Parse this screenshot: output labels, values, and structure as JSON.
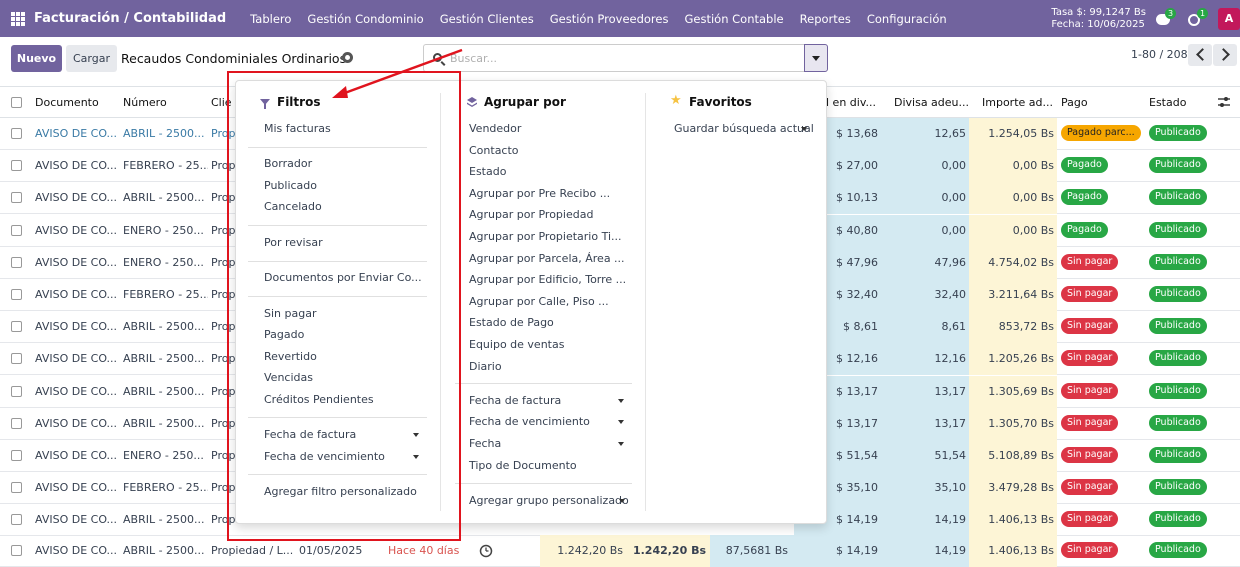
{
  "app": {
    "brand": "Facturación / Contabilidad",
    "menu": [
      "Tablero",
      "Gestión Condominio",
      "Gestión Clientes",
      "Gestión Proveedores",
      "Gestión Contable",
      "Reportes",
      "Configuración"
    ],
    "rate": "Tasa $: 99,1247 Bs",
    "date": "Fecha: 10/06/2025",
    "chat_count": "3",
    "activity_count": "1",
    "avatar": "A"
  },
  "control": {
    "new_label": "Nuevo",
    "upload_label": "Cargar",
    "title": "Recaudos Condominiales Ordinarios",
    "search_placeholder": "Buscar...",
    "pager": "1-80 / 208"
  },
  "table": {
    "headers": [
      "Documento",
      "Número",
      "Clie",
      "l en div...",
      "Divisa adeu...",
      "Importe ad...",
      "Pago",
      "Estado"
    ],
    "rows": [
      {
        "doc": "AVISO DE CO...",
        "num": "ABRIL - 2500...",
        "cli": "Prop",
        "usd": "$ 13,68",
        "div": "12,65",
        "imp": "1.254,05 Bs",
        "pago": "Pagado parc...",
        "pago_type": "orange",
        "estado": "Publicado",
        "link": true
      },
      {
        "doc": "AVISO DE CO...",
        "num": "FEBRERO - 25...",
        "cli": "Prop",
        "usd": "$ 27,00",
        "div": "0,00",
        "imp": "0,00 Bs",
        "pago": "Pagado",
        "pago_type": "green",
        "estado": "Publicado"
      },
      {
        "doc": "AVISO DE CO...",
        "num": "ABRIL - 2500...",
        "cli": "Prop",
        "usd": "$ 10,13",
        "div": "0,00",
        "imp": "0,00 Bs",
        "pago": "Pagado",
        "pago_type": "green",
        "estado": "Publicado"
      },
      {
        "doc": "AVISO DE CO...",
        "num": "ENERO - 250...",
        "cli": "Prop",
        "usd": "$ 40,80",
        "div": "0,00",
        "imp": "0,00 Bs",
        "pago": "Pagado",
        "pago_type": "green",
        "estado": "Publicado"
      },
      {
        "doc": "AVISO DE CO...",
        "num": "ENERO - 250...",
        "cli": "Prop",
        "usd": "$ 47,96",
        "div": "47,96",
        "imp": "4.754,02 Bs",
        "pago": "Sin pagar",
        "pago_type": "red",
        "estado": "Publicado"
      },
      {
        "doc": "AVISO DE CO...",
        "num": "FEBRERO - 25...",
        "cli": "Prop",
        "usd": "$ 32,40",
        "div": "32,40",
        "imp": "3.211,64 Bs",
        "pago": "Sin pagar",
        "pago_type": "red",
        "estado": "Publicado"
      },
      {
        "doc": "AVISO DE CO...",
        "num": "ABRIL - 2500...",
        "cli": "Prop",
        "usd": "$ 8,61",
        "div": "8,61",
        "imp": "853,72 Bs",
        "pago": "Sin pagar",
        "pago_type": "red",
        "estado": "Publicado"
      },
      {
        "doc": "AVISO DE CO...",
        "num": "ABRIL - 2500...",
        "cli": "Prop",
        "usd": "$ 12,16",
        "div": "12,16",
        "imp": "1.205,26 Bs",
        "pago": "Sin pagar",
        "pago_type": "red",
        "estado": "Publicado"
      },
      {
        "doc": "AVISO DE CO...",
        "num": "ABRIL - 2500...",
        "cli": "Prop",
        "usd": "$ 13,17",
        "div": "13,17",
        "imp": "1.305,69 Bs",
        "pago": "Sin pagar",
        "pago_type": "red",
        "estado": "Publicado"
      },
      {
        "doc": "AVISO DE CO...",
        "num": "ABRIL - 2500...",
        "cli": "Prop",
        "usd": "$ 13,17",
        "div": "13,17",
        "imp": "1.305,70 Bs",
        "pago": "Sin pagar",
        "pago_type": "red",
        "estado": "Publicado"
      },
      {
        "doc": "AVISO DE CO...",
        "num": "ENERO - 250...",
        "cli": "Prop",
        "usd": "$ 51,54",
        "div": "51,54",
        "imp": "5.108,89 Bs",
        "pago": "Sin pagar",
        "pago_type": "red",
        "estado": "Publicado"
      },
      {
        "doc": "AVISO DE CO...",
        "num": "FEBRERO - 25...",
        "cli": "Prop",
        "usd": "$ 35,10",
        "div": "35,10",
        "imp": "3.479,28 Bs",
        "pago": "Sin pagar",
        "pago_type": "red",
        "estado": "Publicado"
      },
      {
        "doc": "AVISO DE CO...",
        "num": "ABRIL - 2500...",
        "cli": "Prop",
        "usd": "$ 14,19",
        "div": "14,19",
        "imp": "1.406,13 Bs",
        "pago": "Sin pagar",
        "pago_type": "red",
        "estado": "Publicado"
      }
    ],
    "last_row": {
      "doc": "AVISO DE CO...",
      "num": "ABRIL - 2500...",
      "cli": "Propiedad / L...",
      "date": "01/05/2025",
      "due": "Hace 40 días",
      "amount1": "1.242,20 Bs",
      "amount2": "1.242,20 Bs",
      "rate": "87,5681 Bs",
      "usd": "$ 14,19",
      "div": "14,19",
      "imp": "1.406,13 Bs",
      "pago": "Sin pagar",
      "estado": "Publicado"
    }
  },
  "filters": {
    "title": "Filtros",
    "groups": [
      [
        "Mis facturas"
      ],
      [
        "Borrador",
        "Publicado",
        "Cancelado"
      ],
      [
        "Por revisar"
      ],
      [
        "Documentos por Enviar Co..."
      ],
      [
        "Sin pagar",
        "Pagado",
        "Revertido",
        "Vencidas",
        "Créditos Pendientes"
      ],
      [
        "Fecha de factura",
        "Fecha de vencimiento"
      ],
      [
        "Agregar filtro personalizado"
      ]
    ]
  },
  "groupby": {
    "title": "Agrupar por",
    "items": [
      "Vendedor",
      "Contacto",
      "Estado",
      "Agrupar por Pre Recibo ...",
      "Agrupar por Propiedad",
      "Agrupar por Propietario Ti...",
      "Agrupar por Parcela, Área ...",
      "Agrupar por Edificio, Torre ...",
      "Agrupar por Calle, Piso ...",
      "Estado de Pago",
      "Equipo de ventas",
      "Diario"
    ],
    "date_items": [
      "Fecha de factura",
      "Fecha de vencimiento",
      "Fecha"
    ],
    "doc_type": "Tipo de Documento",
    "custom": "Agregar grupo personalizado"
  },
  "favorites": {
    "title": "Favoritos",
    "save": "Guardar búsqueda actual"
  },
  "colors": {
    "brand": "#71639e",
    "annotation": "#e0141e"
  }
}
